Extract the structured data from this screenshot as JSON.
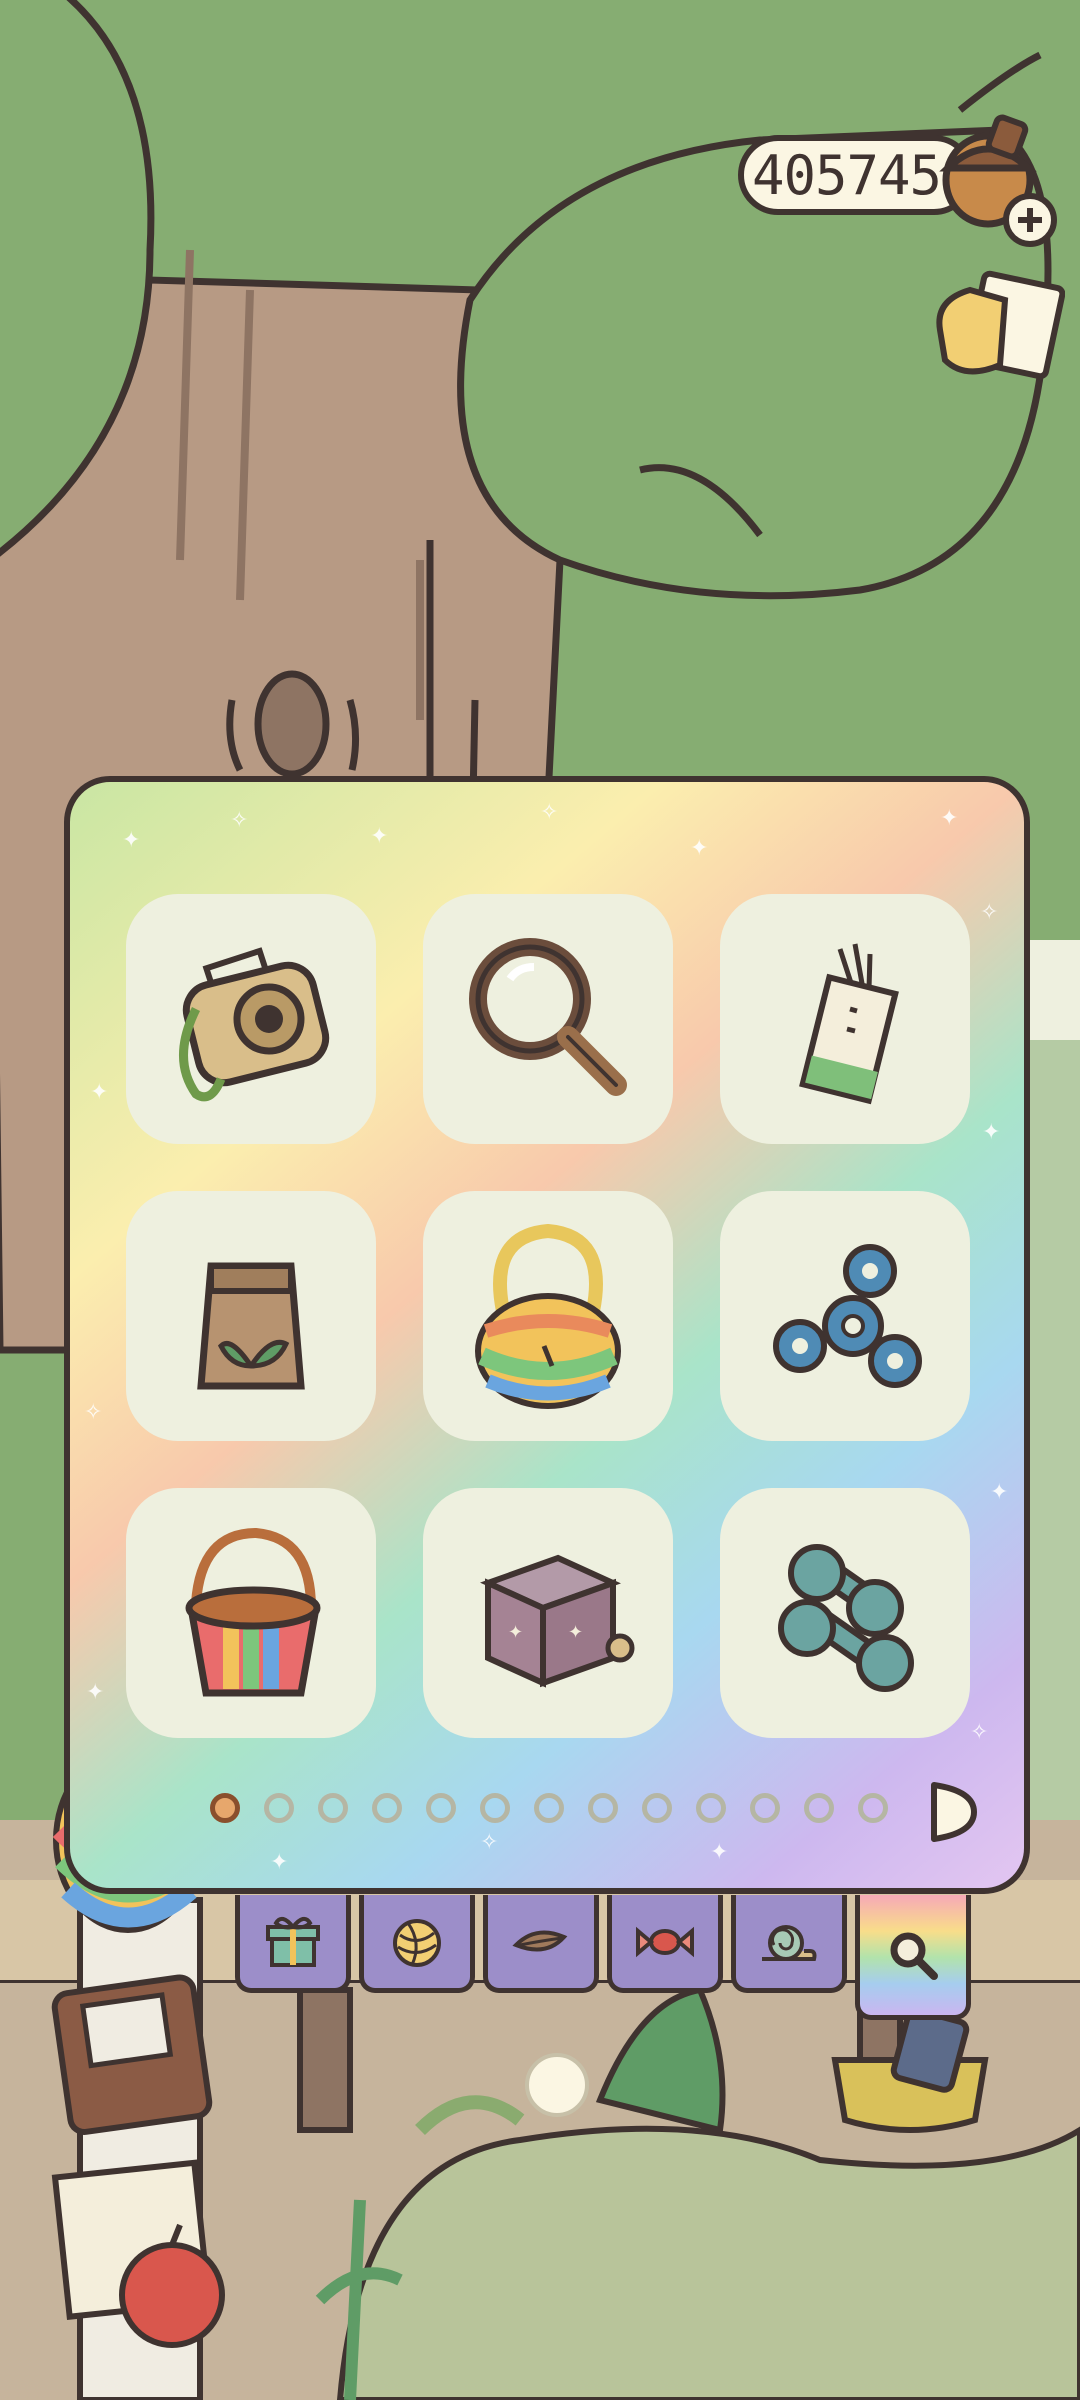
{
  "header": {
    "acorn_count": "405745",
    "acorn_badge_icon": "acorn-plus-icon",
    "stamp_button_icon": "stamp-card-icon"
  },
  "inventory": {
    "items": [
      {
        "name": "instant-camera",
        "icon": "camera-icon"
      },
      {
        "name": "magnifying-glass",
        "icon": "magnifying-glass-icon"
      },
      {
        "name": "incense-sticks",
        "icon": "incense-icon"
      },
      {
        "name": "seed-bag",
        "icon": "seed-bag-icon"
      },
      {
        "name": "rainbow-fluffy-bag",
        "icon": "fluffy-bag-icon"
      },
      {
        "name": "fidget-spinner",
        "icon": "fidget-spinner-icon"
      },
      {
        "name": "rainbow-bucket",
        "icon": "bucket-icon"
      },
      {
        "name": "music-box",
        "icon": "music-box-icon"
      },
      {
        "name": "dumbbells",
        "icon": "dumbbell-icon"
      }
    ],
    "page_indicator": {
      "current": 1,
      "total": 13
    },
    "next_page_icon": "next-arrow-icon"
  },
  "tabs": [
    {
      "name": "gifts",
      "icon": "gift-icon"
    },
    {
      "name": "yarn",
      "icon": "yarn-icon"
    },
    {
      "name": "leaf",
      "icon": "leaf-icon"
    },
    {
      "name": "candy",
      "icon": "candy-icon"
    },
    {
      "name": "snail",
      "icon": "snail-icon"
    },
    {
      "name": "tools",
      "icon": "magnifier-tab-icon",
      "active": true
    }
  ],
  "colors": {
    "outline": "#3f3330",
    "background_green": "#86ad72",
    "cell_background": "#eef0df",
    "tab_purple": "#9c8ec9",
    "active_dot": "#e7a76c"
  }
}
